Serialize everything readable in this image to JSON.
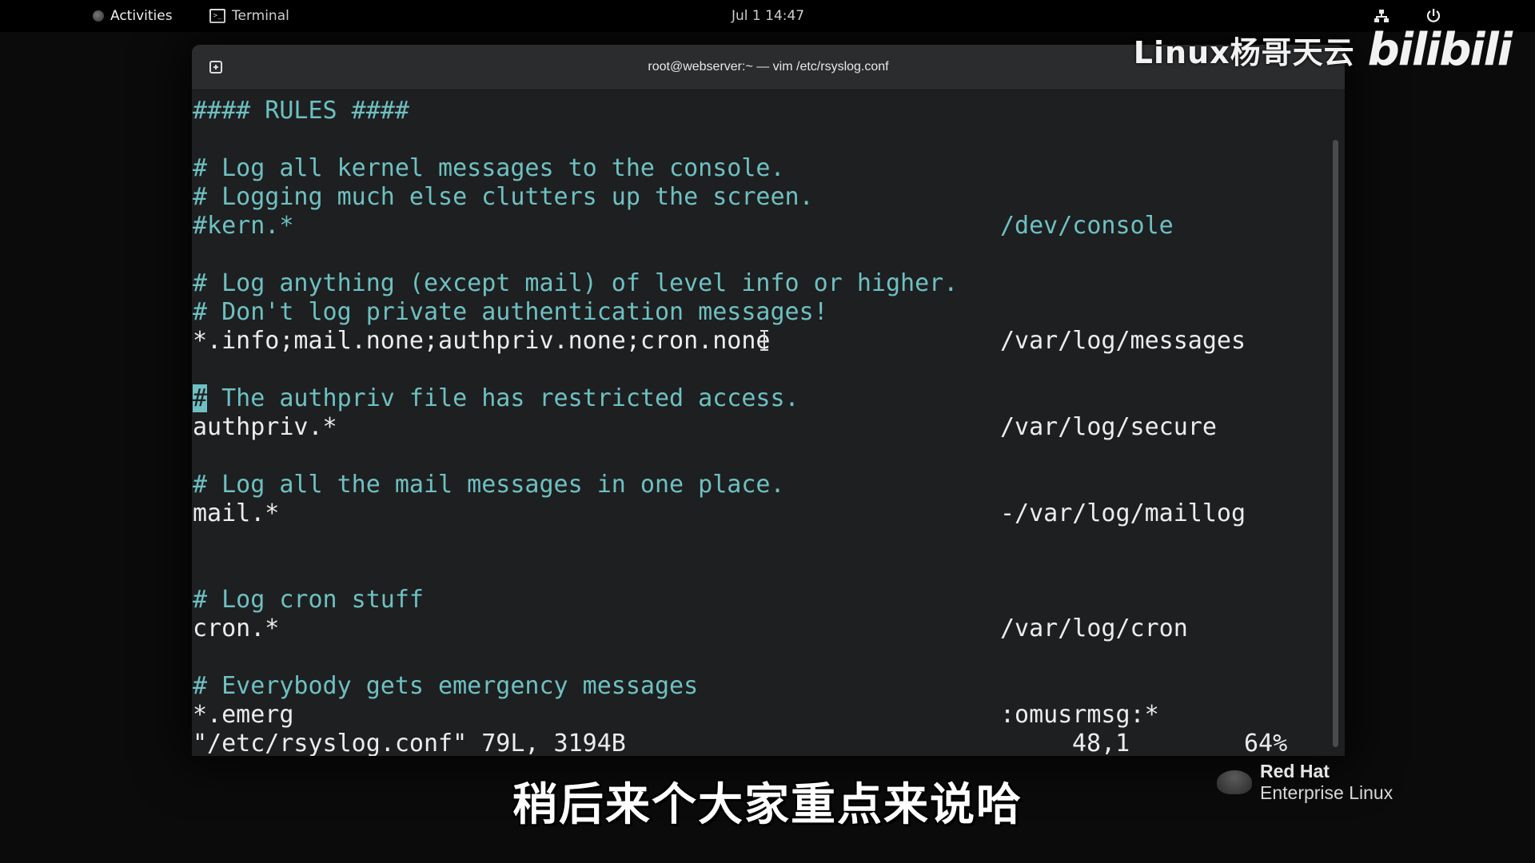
{
  "topbar": {
    "activities": "Activities",
    "app_name": "Terminal",
    "clock": "Jul 1  14:47",
    "network_icon": "network-icon",
    "power_icon": "power-icon"
  },
  "window": {
    "title": "root@webserver:~ — vim /etc/rsyslog.conf",
    "new_tab_icon": "new-tab-icon"
  },
  "terminal": {
    "lines": [
      {
        "c1": "#### RULES ####",
        "c2": "",
        "type": "comment"
      },
      {
        "c1": "",
        "c2": "",
        "type": "blank"
      },
      {
        "c1": "# Log all kernel messages to the console.",
        "c2": "",
        "type": "comment"
      },
      {
        "c1": "# Logging much else clutters up the screen.",
        "c2": "",
        "type": "comment"
      },
      {
        "c1": "#kern.*",
        "c2": "/dev/console",
        "type": "comment"
      },
      {
        "c1": "",
        "c2": "",
        "type": "blank"
      },
      {
        "c1": "# Log anything (except mail) of level info or higher.",
        "c2": "",
        "type": "comment"
      },
      {
        "c1": "# Don't log private authentication messages!",
        "c2": "",
        "type": "comment"
      },
      {
        "c1": "*.info;mail.none;authpriv.none;cron.none",
        "c2": "/var/log/messages",
        "type": "rule"
      },
      {
        "c1": "",
        "c2": "",
        "type": "blank"
      },
      {
        "c1": " The authpriv file has restricted access.",
        "c2": "",
        "type": "cursor",
        "cursor_char": "#"
      },
      {
        "c1": "authpriv.*",
        "c2": "/var/log/secure",
        "type": "rule"
      },
      {
        "c1": "",
        "c2": "",
        "type": "blank"
      },
      {
        "c1": "# Log all the mail messages in one place.",
        "c2": "",
        "type": "comment"
      },
      {
        "c1": "mail.*",
        "c2": "-/var/log/maillog",
        "type": "rule"
      },
      {
        "c1": "",
        "c2": "",
        "type": "blank"
      },
      {
        "c1": "",
        "c2": "",
        "type": "blank"
      },
      {
        "c1": "# Log cron stuff",
        "c2": "",
        "type": "comment"
      },
      {
        "c1": "cron.*",
        "c2": "/var/log/cron",
        "type": "rule"
      },
      {
        "c1": "",
        "c2": "",
        "type": "blank"
      },
      {
        "c1": "# Everybody gets emergency messages",
        "c2": "",
        "type": "comment"
      },
      {
        "c1": "*.emerg",
        "c2": ":omusrmsg:*",
        "type": "rule"
      }
    ],
    "status": {
      "file": "\"/etc/rsyslog.conf\" 79L, 3194B",
      "position": "48,1",
      "percent": "64%"
    }
  },
  "overlay": {
    "watermark_text": "Linux杨哥天云",
    "watermark_logo": "bilibili",
    "subtitle": "稍后来个大家重点来说哈",
    "brand_line1": "Red Hat",
    "brand_line2": "Enterprise Linux"
  }
}
